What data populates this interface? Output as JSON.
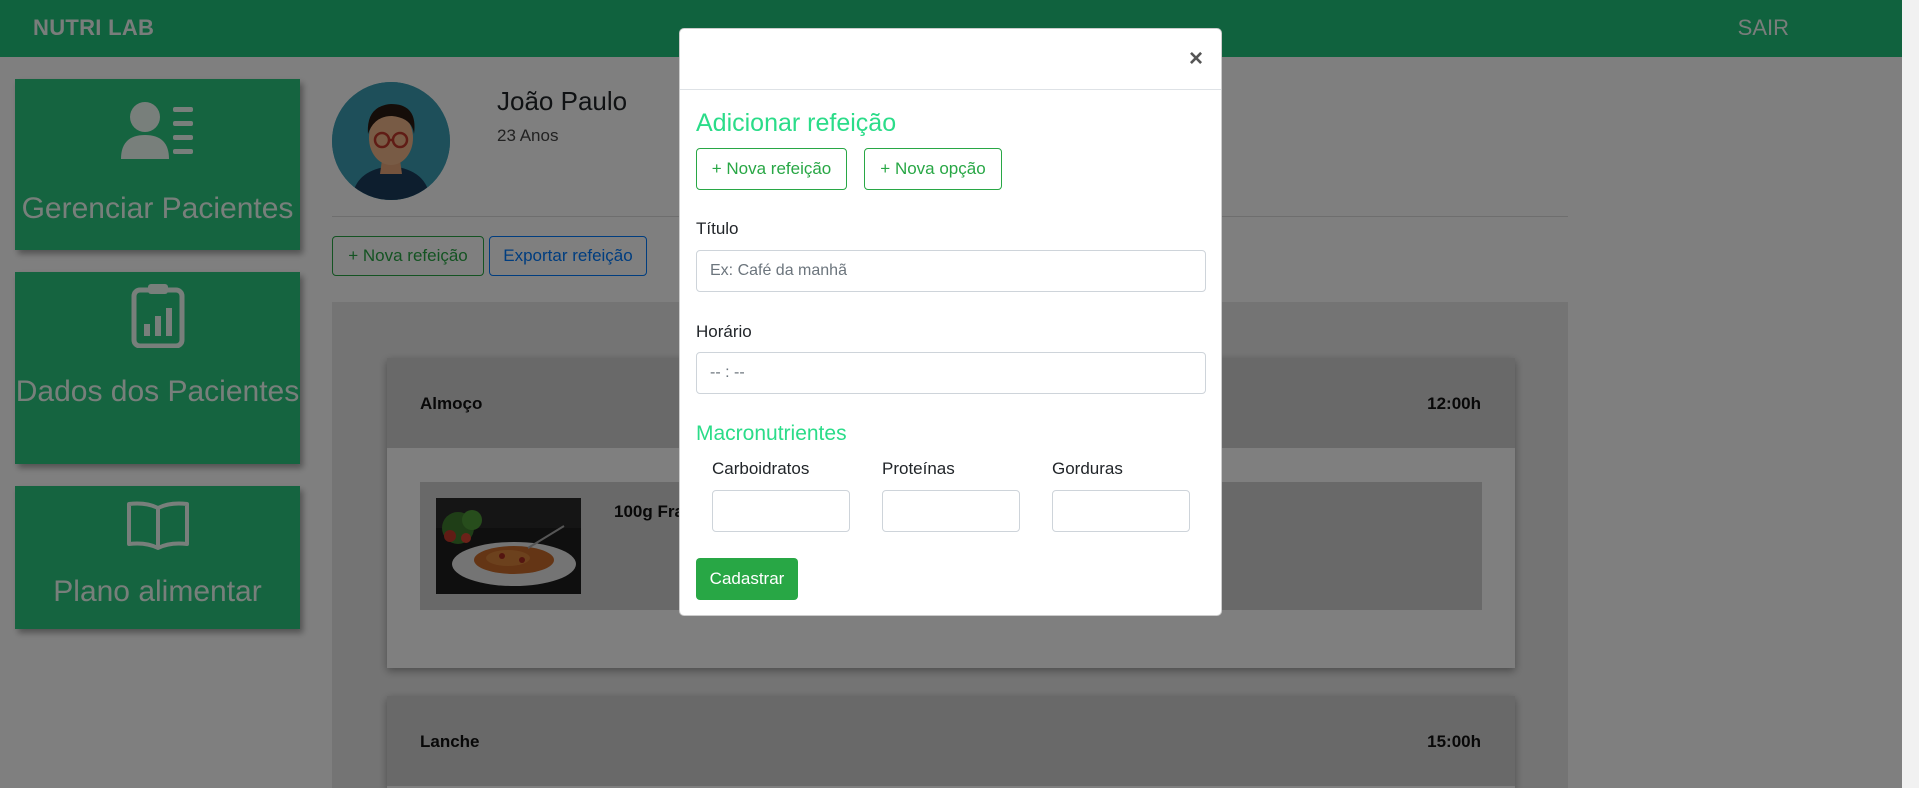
{
  "navbar": {
    "brand": "NUTRI LAB",
    "logout": "SAIR"
  },
  "sidebar": {
    "items": [
      {
        "label": "Gerenciar Pacientes",
        "icon": "user-list-icon"
      },
      {
        "label": "Dados dos Pacientes",
        "icon": "clipboard-chart-icon"
      },
      {
        "label": "Plano alimentar",
        "icon": "open-book-icon"
      }
    ]
  },
  "patient": {
    "name": "João Paulo",
    "age": "23 Anos"
  },
  "actions": {
    "new_meal": "+ Nova refeição",
    "export_meal": "Exportar refeição"
  },
  "meals": [
    {
      "title": "Almoço",
      "time": "12:00h",
      "option_text": "100g Fra"
    },
    {
      "title": "Lanche",
      "time": "15:00h"
    }
  ],
  "modal": {
    "close": "×",
    "title": "Adicionar refeição",
    "new_meal_button": "+ Nova refeição",
    "new_option_button": "+ Nova opção",
    "title_label": "Título",
    "title_placeholder": "Ex: Café da manhã",
    "time_label": "Horário",
    "time_placeholder": "-- : --",
    "macros_title": "Macronutrientes",
    "carbs_label": "Carboidratos",
    "protein_label": "Proteínas",
    "fat_label": "Gorduras",
    "submit": "Cadastrar"
  },
  "colors": {
    "brand_green": "#20c47c",
    "accent_green": "#2bdc89",
    "success": "#28a745",
    "primary": "#007bff"
  }
}
